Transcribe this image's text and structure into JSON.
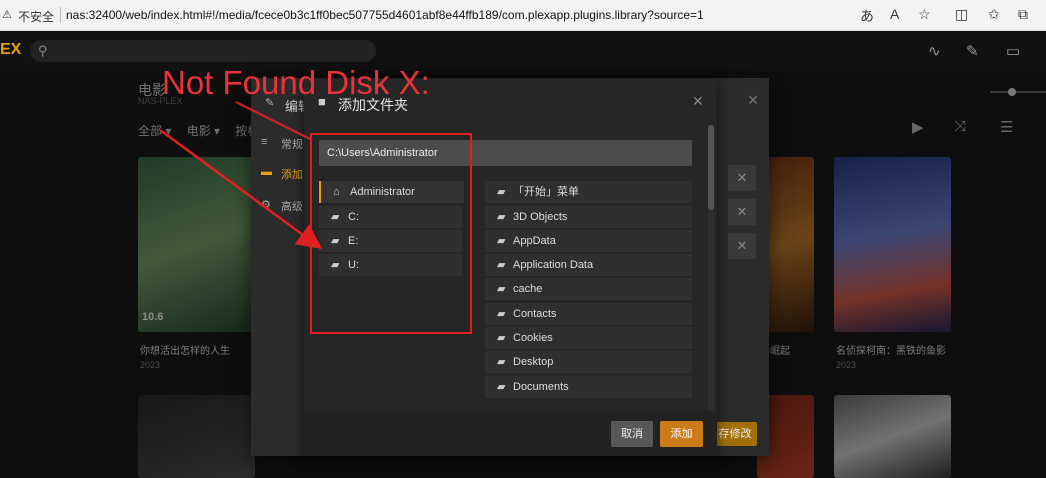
{
  "browser": {
    "security_label": "不安全",
    "url": "nas:32400/web/index.html#!/media/fcece0b3c1ff0bec507755d4601abf8e44ffb189/com.plexapp.plugins.library?source=1"
  },
  "plex": {
    "logo": "EX",
    "library_title": "电影",
    "library_sub": "NAS-PLEX",
    "filters": [
      "全部 ▾",
      "电影 ▾",
      "按标"
    ]
  },
  "posters": [
    {
      "title": "你想活出怎样的人生",
      "year": "2023",
      "tag": "10.6"
    },
    {
      "title": "士崛起",
      "year": ""
    },
    {
      "title": "名侦探柯南：黑铁的鱼影",
      "year": "2023"
    }
  ],
  "outer_modal": {
    "header": "编辑",
    "nav": [
      "常规",
      "添加",
      "高级"
    ],
    "save_label": "存修改"
  },
  "dialog": {
    "title": "添加文件夹",
    "path": "C:\\Users\\Administrator",
    "drives": [
      {
        "label": "Administrator",
        "icon": "home-icon"
      },
      {
        "label": "C:",
        "icon": "folder-icon"
      },
      {
        "label": "E:",
        "icon": "folder-icon"
      },
      {
        "label": "U:",
        "icon": "folder-icon"
      }
    ],
    "folders": [
      {
        "label": "「开始」菜单"
      },
      {
        "label": "3D Objects"
      },
      {
        "label": "AppData"
      },
      {
        "label": "Application Data"
      },
      {
        "label": "cache"
      },
      {
        "label": "Contacts"
      },
      {
        "label": "Cookies"
      },
      {
        "label": "Desktop"
      },
      {
        "label": "Documents"
      }
    ],
    "cancel_label": "取消",
    "add_label": "添加"
  },
  "annotation": {
    "text": "Not Found Disk X:",
    "color": "#e02020"
  }
}
